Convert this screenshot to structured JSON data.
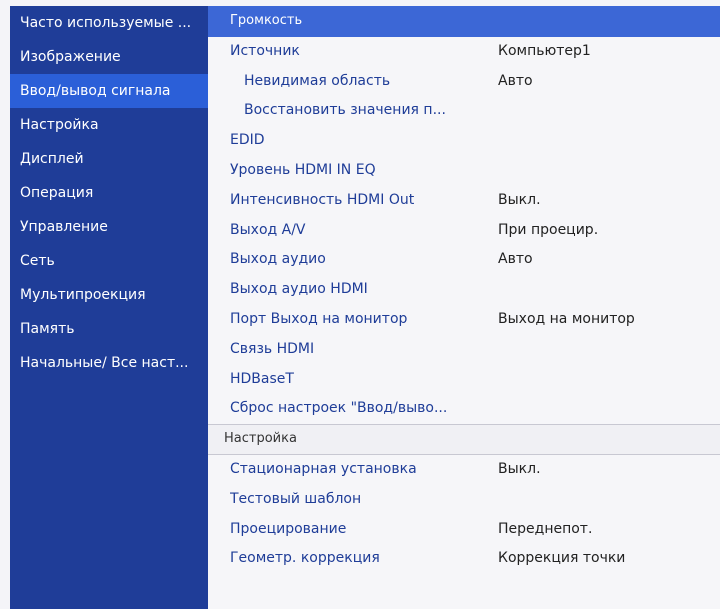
{
  "sidebar": {
    "items": [
      {
        "label": "Часто используемые ..."
      },
      {
        "label": "Изображение"
      },
      {
        "label": "Ввод/вывод сигнала"
      },
      {
        "label": "Настройка"
      },
      {
        "label": "Дисплей"
      },
      {
        "label": "Операция"
      },
      {
        "label": "Управление"
      },
      {
        "label": "Сеть"
      },
      {
        "label": "Мультипроекция"
      },
      {
        "label": "Память"
      },
      {
        "label": "Начальные/ Все наст..."
      }
    ],
    "selected_index": 2
  },
  "main": {
    "header": "Громкость",
    "rows": [
      {
        "label": "Источник",
        "value": "Компьютер1"
      },
      {
        "label": "Невидимая область",
        "value": "Авто"
      },
      {
        "label": "Восстановить значения п...",
        "value": ""
      },
      {
        "label": "EDID",
        "value": ""
      },
      {
        "label": "Уровень HDMI IN EQ",
        "value": ""
      },
      {
        "label": "Интенсивность HDMI Out",
        "value": "Выкл."
      },
      {
        "label": "Выход A/V",
        "value": "При проецир."
      },
      {
        "label": "Выход аудио",
        "value": "Авто"
      },
      {
        "label": "Выход аудио HDMI",
        "value": ""
      },
      {
        "label": "Порт Выход на монитор",
        "value": "Выход на монитор"
      },
      {
        "label": "Связь HDMI",
        "value": ""
      },
      {
        "label": "HDBaseT",
        "value": ""
      },
      {
        "label": "Сброс настроек \"Ввод/выво...",
        "value": ""
      }
    ],
    "section_title": "Настройка",
    "section_rows": [
      {
        "label": "Стационарная установка",
        "value": "Выкл."
      },
      {
        "label": "Тестовый шаблон",
        "value": ""
      },
      {
        "label": "Проецирование",
        "value": "Переднепот."
      },
      {
        "label": "Геометр. коррекция",
        "value": "Коррекция точки"
      }
    ]
  }
}
